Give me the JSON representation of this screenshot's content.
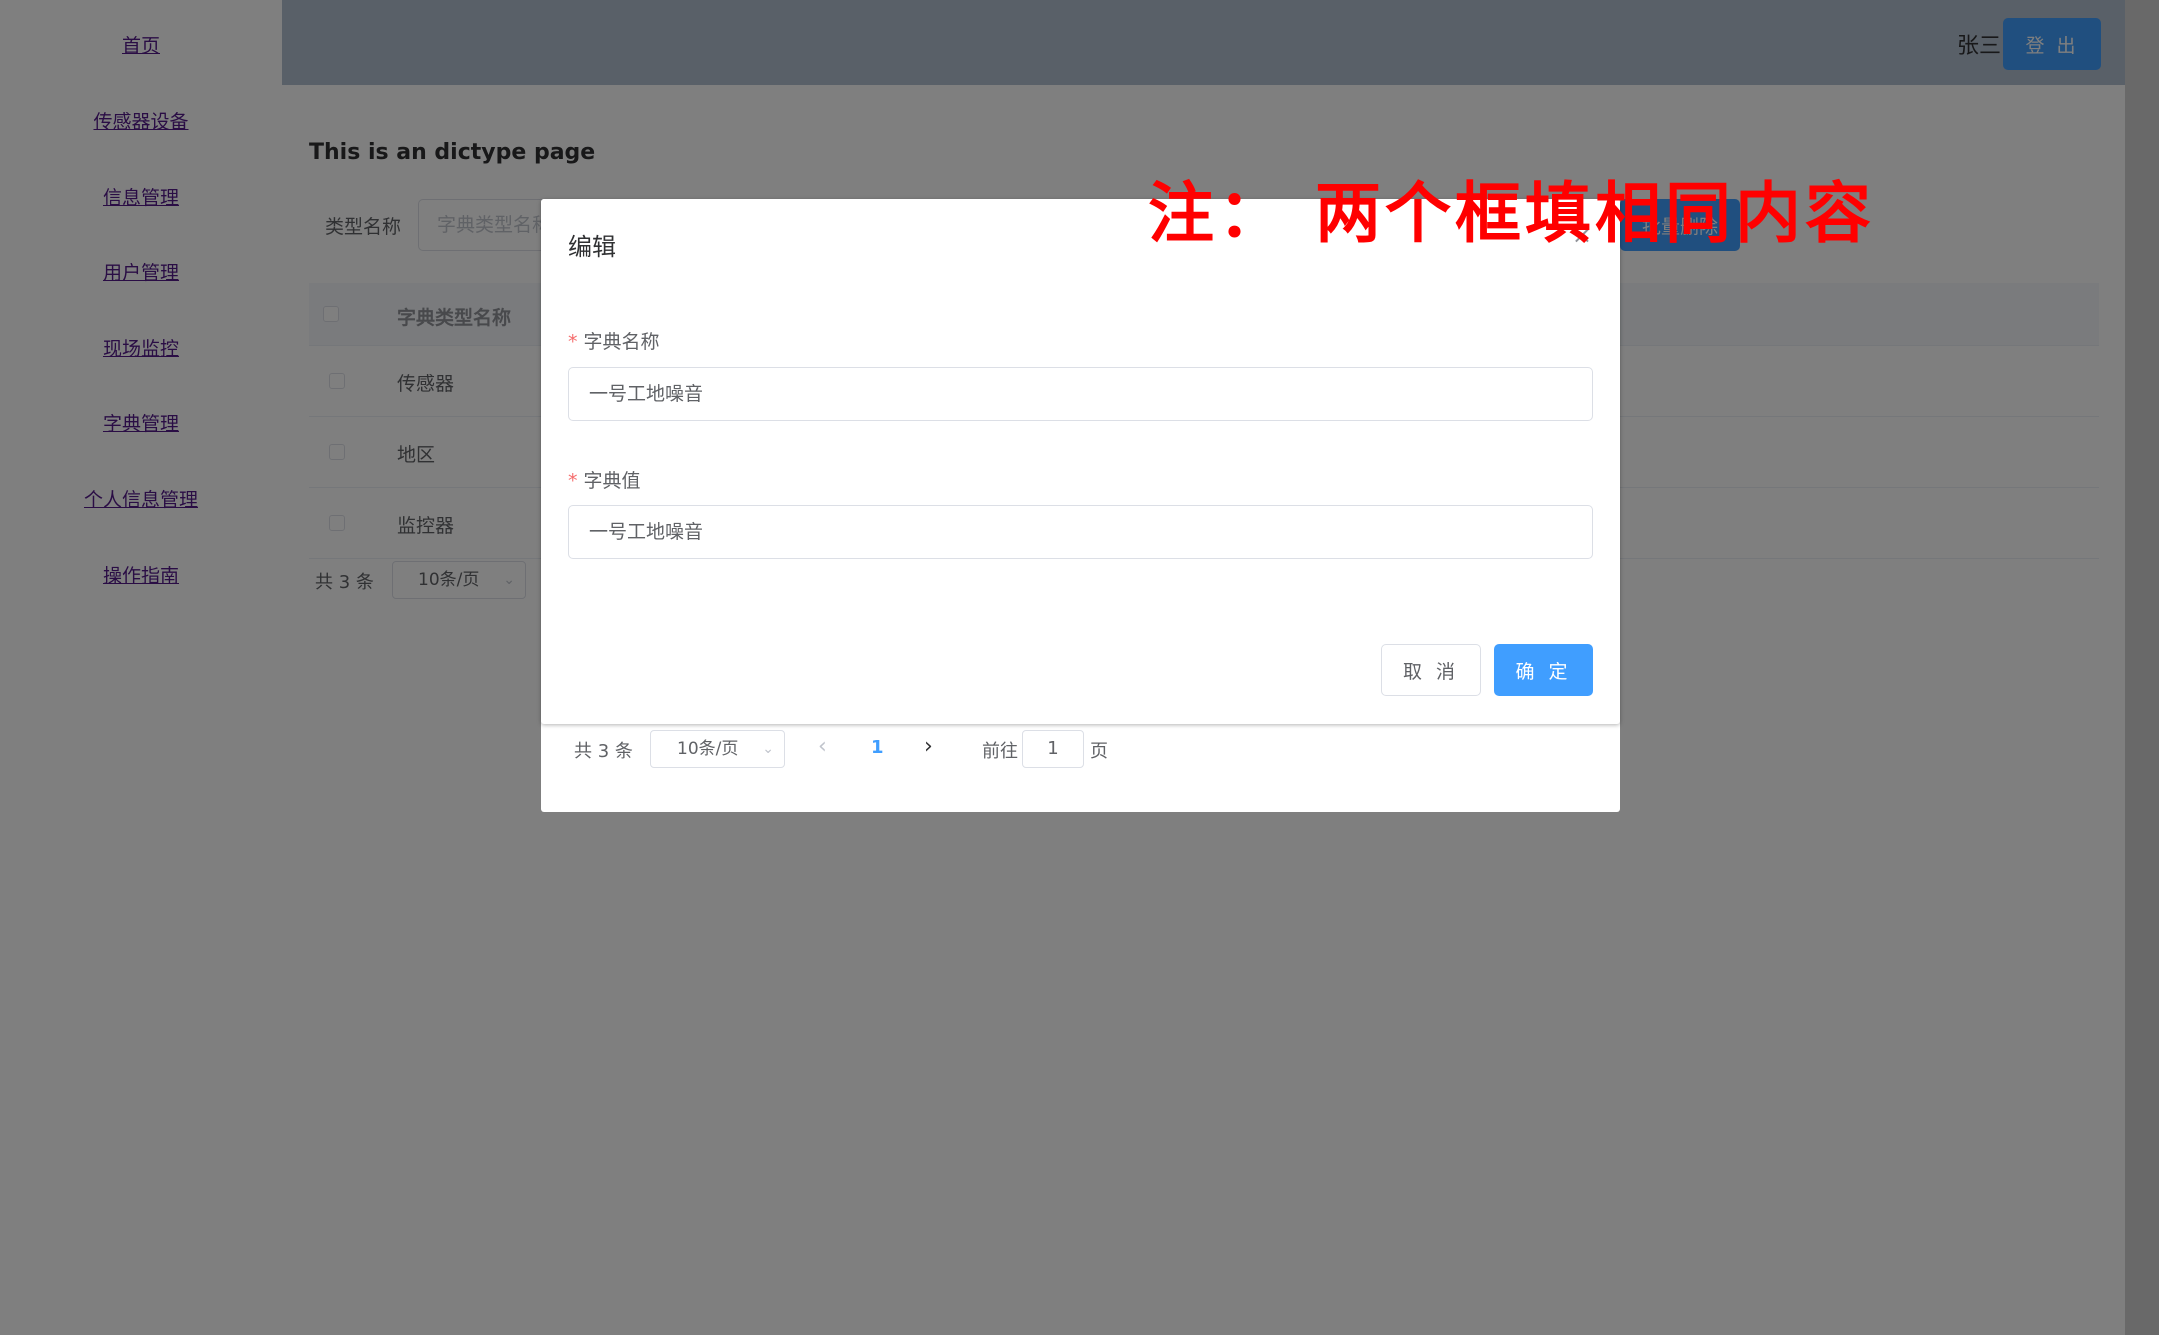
{
  "sidebar": {
    "items": [
      {
        "label": "首页"
      },
      {
        "label": "传感器设备"
      },
      {
        "label": "信息管理"
      },
      {
        "label": "用户管理"
      },
      {
        "label": "现场监控"
      },
      {
        "label": "字典管理"
      },
      {
        "label": "个人信息管理"
      },
      {
        "label": "操作指南"
      }
    ]
  },
  "header": {
    "username": "张三",
    "logout_label": "登 出"
  },
  "page": {
    "title": "This is an dictype page",
    "search": {
      "label": "类型名称",
      "placeholder": "字典类型名称"
    },
    "delete_label": "批量删除",
    "table": {
      "header": "字典类型名称",
      "rows": [
        {
          "name": "传感器"
        },
        {
          "name": "地区"
        },
        {
          "name": "监控器"
        }
      ]
    },
    "pagination": {
      "total": "共 3 条",
      "page_size": "10条/页"
    }
  },
  "list_dialog": {
    "pagination": {
      "total": "共 3 条",
      "page_size": "10条/页",
      "prev": "‹",
      "current_page": "1",
      "next": "›",
      "goto_prefix": "前往",
      "goto_value": "1",
      "goto_suffix": "页"
    }
  },
  "edit_dialog": {
    "title": "编辑",
    "close_icon": "×",
    "fields": [
      {
        "label": "字典名称",
        "value": "一号工地噪音"
      },
      {
        "label": "字典值",
        "value": "一号工地噪音"
      }
    ],
    "cancel_label": "取 消",
    "confirm_label": "确 定"
  },
  "annotation": {
    "text": "注： 两个框填相同内容",
    "color": "#ff0000"
  },
  "colors": {
    "primary": "#409eff",
    "header_bg": "#b3c0d1",
    "required": "#f56c6c"
  }
}
